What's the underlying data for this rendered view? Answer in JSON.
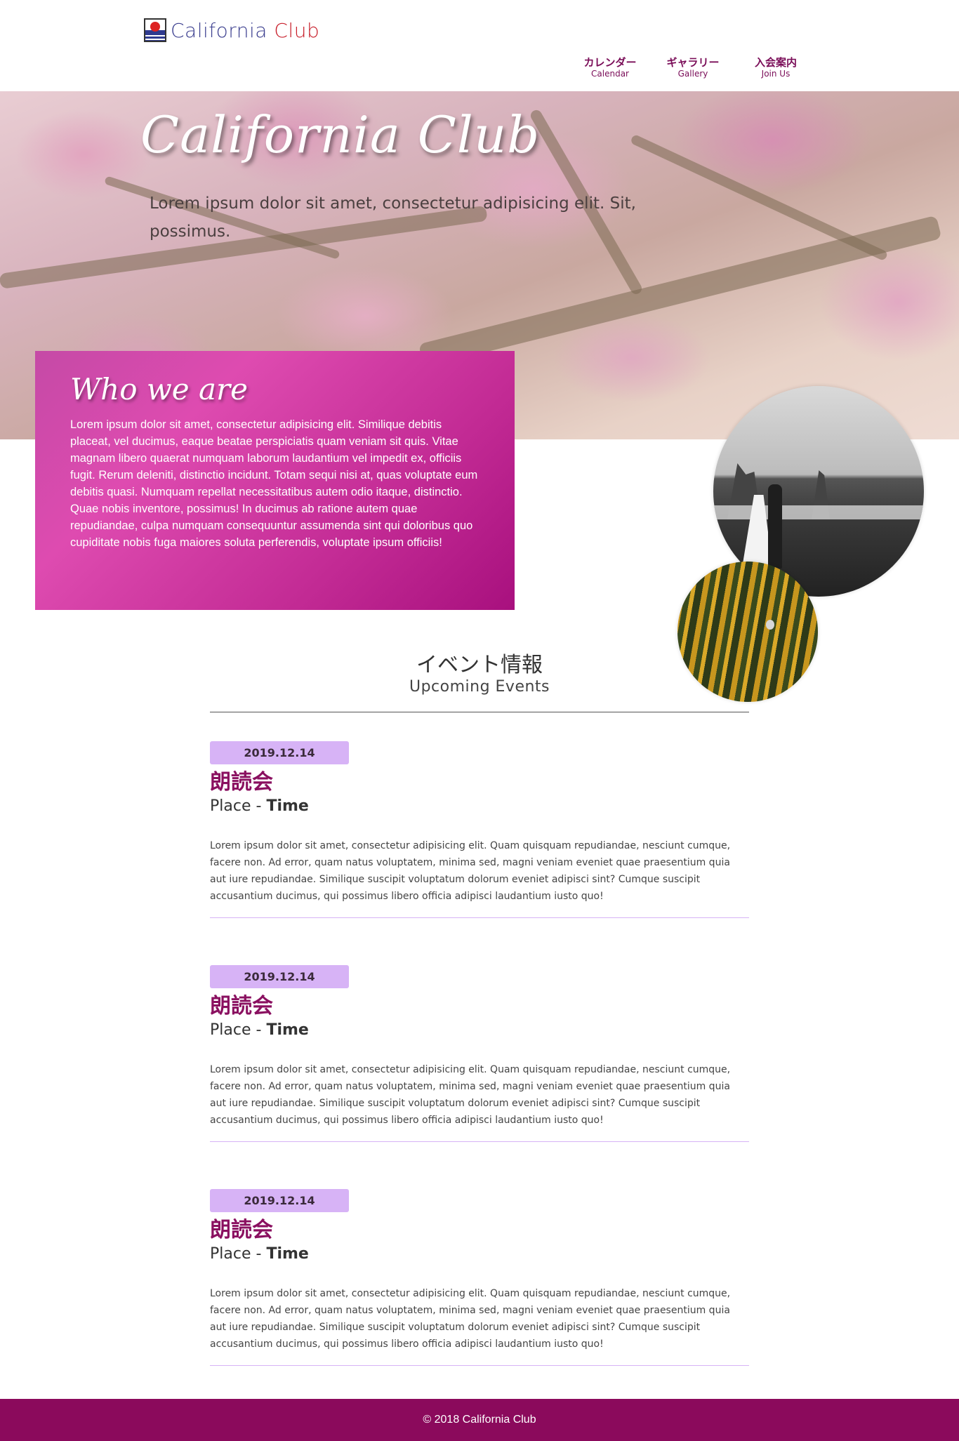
{
  "header": {
    "logo_text_a": "California",
    "logo_text_b": "Club",
    "nav": [
      {
        "jp": "カレンダー",
        "en": "Calendar"
      },
      {
        "jp": "ギャラリー",
        "en": "Gallery"
      },
      {
        "jp": "入会案内",
        "en": "Join Us"
      }
    ]
  },
  "hero": {
    "title": "California Club",
    "subtitle": "Lorem ipsum dolor sit amet, consectetur adipisicing elit. Sit, possimus."
  },
  "about": {
    "title": "Who we are",
    "body": "Lorem ipsum dolor sit amet, consectetur adipisicing elit. Similique debitis placeat, vel ducimus, eaque beatae perspiciatis quam veniam sit quis. Vitae magnam libero quaerat numquam laborum laudantium vel impedit ex, officiis fugit. Rerum deleniti, distinctio incidunt. Totam sequi nisi at, quas voluptate eum debitis quasi. Numquam repellat necessitatibus autem odio itaque, distinctio. Quae nobis inventore, possimus! In ducimus ab ratione autem quae repudiandae, culpa numquam consequuntur assumenda sint qui doloribus quo cupiditate nobis fuga maiores soluta perferendis, voluptate ipsum officiis!"
  },
  "events": {
    "heading_jp": "イベント情報",
    "heading_en": "Upcoming Events",
    "items": [
      {
        "date": "2019.12.14",
        "title": "朗読会",
        "place": "Place -",
        "time": "Time",
        "desc": "Lorem ipsum dolor sit amet, consectetur adipisicing elit. Quam quisquam repudiandae, nesciunt cumque, facere non. Ad error, quam natus voluptatem, minima sed, magni veniam eveniet quae praesentium quia aut iure repudiandae. Similique suscipit voluptatum dolorum eveniet adipisci sint? Cumque suscipit accusantium ducimus, qui possimus libero officia adipisci laudantium iusto quo!"
      },
      {
        "date": "2019.12.14",
        "title": "朗読会",
        "place": "Place -",
        "time": "Time",
        "desc": "Lorem ipsum dolor sit amet, consectetur adipisicing elit. Quam quisquam repudiandae, nesciunt cumque, facere non. Ad error, quam natus voluptatem, minima sed, magni veniam eveniet quae praesentium quia aut iure repudiandae. Similique suscipit voluptatum dolorum eveniet adipisci sint? Cumque suscipit accusantium ducimus, qui possimus libero officia adipisci laudantium iusto quo!"
      },
      {
        "date": "2019.12.14",
        "title": "朗読会",
        "place": "Place -",
        "time": "Time",
        "desc": "Lorem ipsum dolor sit amet, consectetur adipisicing elit. Quam quisquam repudiandae, nesciunt cumque, facere non. Ad error, quam natus voluptatem, minima sed, magni veniam eveniet quae praesentium quia aut iure repudiandae. Similique suscipit voluptatum dolorum eveniet adipisci sint? Cumque suscipit accusantium ducimus, qui possimus libero officia adipisci laudantium iusto quo!"
      }
    ]
  },
  "footer": {
    "copyright": "© 2018 California Club"
  },
  "colors": {
    "brand": "#8b0a5c",
    "accent": "#d7b3f6",
    "who_bg": "#c22a94"
  }
}
